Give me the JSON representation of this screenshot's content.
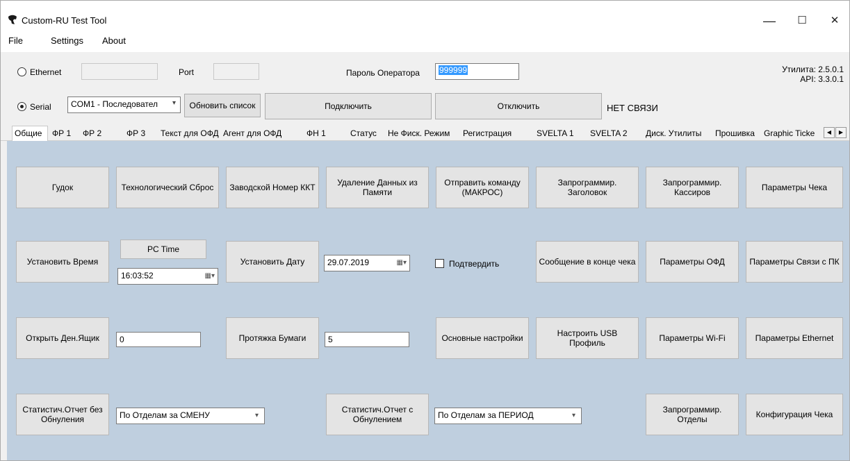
{
  "window": {
    "title": "Custom-RU Test Tool",
    "app_icon": "app-icon",
    "controls": {
      "minimize": "—",
      "maximize": "☐",
      "close": "✕"
    }
  },
  "menu": {
    "file": "File",
    "settings": "Settings",
    "about": "About"
  },
  "connection": {
    "ethernet_label": "Ethernet",
    "port_label": "Port",
    "password_label": "Пароль Оператора",
    "password_value": "999999",
    "serial_label": "Serial",
    "serial_port_value": "COM1 - Последовател",
    "refresh_label": "Обновить список",
    "connect_label": "Подключить",
    "disconnect_label": "Отключить",
    "status": "НЕТ СВЯЗИ",
    "ethernet_selected": false,
    "serial_selected": true
  },
  "versions": {
    "utility": "Утилита: 2.5.0.1",
    "api": "API: 3.3.0.1"
  },
  "tabs": [
    "Общие",
    "ФР 1",
    "ФР 2",
    "ФР 3",
    "Текст для ОФД",
    "Агент для ОФД",
    "ФН 1",
    "Статус",
    "Не Фиск. Режим",
    "Регистрация",
    "SVELTA 1",
    "SVELTA 2",
    "Диск. Утилиты",
    "Прошивка",
    "Graphic Ticke"
  ],
  "active_tab": "Общие",
  "general": {
    "row1": {
      "beep": "Гудок",
      "tech_reset": "Технологический Сброс",
      "serial_number": "Заводской Номер ККТ",
      "delete_data": "Удаление Данных из Памяти",
      "send_macro": "Отправить команду (МАКРОС)",
      "program_header": "Запрограммир. Заголовок",
      "program_cashiers": "Запрограммир. Кассиров",
      "receipt_params": "Параметры Чека"
    },
    "row2": {
      "set_time": "Установить Время",
      "pc_time": "PC Time",
      "time_value": "16:03:52",
      "set_date": "Установить Дату",
      "date_value": "29.07.2019",
      "confirm_label": "Подтвердить",
      "end_message": "Сообщение в конце чека",
      "ofd_params": "Параметры ОФД",
      "pc_link_params": "Параметры Связи с ПК"
    },
    "row3": {
      "open_drawer": "Открыть Ден.Ящик",
      "drawer_value": "0",
      "paper_feed": "Протяжка Бумаги",
      "feed_value": "5",
      "basic_settings": "Основные настройки",
      "usb_profile": "Настроить USB Профиль",
      "wifi_params": "Параметры Wi-Fi",
      "ethernet_params": "Параметры Ethernet"
    },
    "row4": {
      "stat_no_reset": "Статистич.Отчет без Обнуления",
      "shift_select": "По Отделам за СМЕНУ",
      "stat_reset": "Статистич.Отчет с Обнулением",
      "period_select": "По Отделам за ПЕРИОД",
      "program_departments": "Запрограммир. Отделы",
      "receipt_config": "Конфигурация Чека"
    }
  }
}
